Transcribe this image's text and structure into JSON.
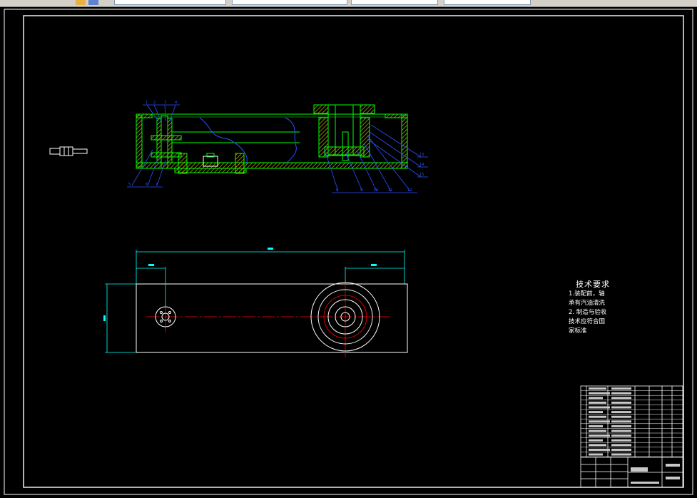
{
  "toolbar": {
    "fields": [
      "",
      "",
      "",
      ""
    ]
  },
  "tech_requirements": {
    "title": "技术要求",
    "lines": [
      "1.装配前，轴",
      "承有汽油清洗",
      "2. 制造与验收",
      "技术应符合国",
      "家标准"
    ]
  },
  "balloons_top_left": [
    "1",
    "2",
    "3",
    "4"
  ],
  "balloons_bottom_left": [
    "5",
    "6",
    "7"
  ],
  "balloons_bottom_right": [
    "8",
    "9",
    "10",
    "11",
    "12"
  ],
  "balloons_right": [
    "13",
    "14",
    "15"
  ],
  "colors": {
    "frame": "#ffffff",
    "part": "#00ff00",
    "hatch": "#c8c800",
    "leader": "#2a52ff",
    "dimension": "#00ffff",
    "centerline": "#ff0000",
    "circle": "#ffffff"
  }
}
